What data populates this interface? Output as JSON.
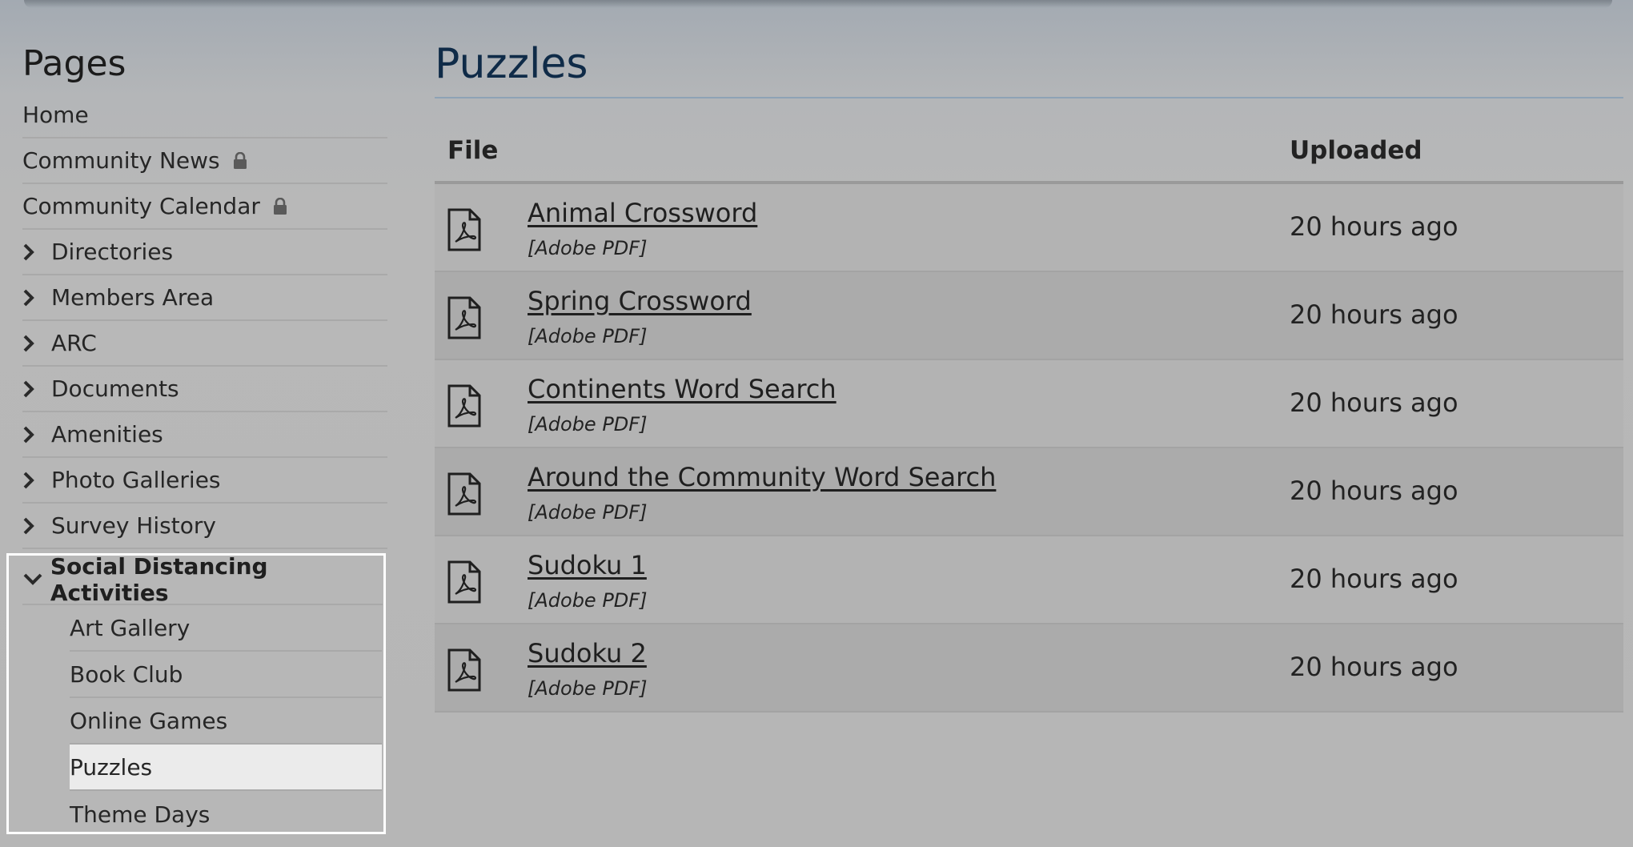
{
  "sidebar": {
    "title": "Pages",
    "items": [
      {
        "label": "Home",
        "icon": "",
        "locked": false
      },
      {
        "label": "Community News",
        "icon": "lock-icon",
        "locked": true
      },
      {
        "label": "Community Calendar",
        "icon": "lock-icon",
        "locked": true
      },
      {
        "label": "Directories",
        "icon": "chevron-right-icon",
        "locked": false
      },
      {
        "label": "Members Area",
        "icon": "chevron-right-icon",
        "locked": false
      },
      {
        "label": "ARC",
        "icon": "chevron-right-icon",
        "locked": false
      },
      {
        "label": "Documents",
        "icon": "chevron-right-icon",
        "locked": false
      },
      {
        "label": "Amenities",
        "icon": "chevron-right-icon",
        "locked": false
      },
      {
        "label": "Photo Galleries",
        "icon": "chevron-right-icon",
        "locked": false
      },
      {
        "label": "Survey History",
        "icon": "chevron-right-icon",
        "locked": false
      }
    ],
    "expanded": {
      "label": "Social Distancing Activities",
      "icon": "chevron-down-icon",
      "children": [
        {
          "label": "Art Gallery"
        },
        {
          "label": "Book Club"
        },
        {
          "label": "Online Games"
        },
        {
          "label": "Puzzles",
          "active": true
        },
        {
          "label": "Theme Days"
        }
      ]
    }
  },
  "main": {
    "title": "Puzzles",
    "columns": {
      "file": "File",
      "uploaded": "Uploaded"
    },
    "files": [
      {
        "name": "Animal Crossword",
        "type": "[Adobe PDF]",
        "uploaded": "20 hours ago",
        "icon": "pdf-file-icon"
      },
      {
        "name": "Spring Crossword",
        "type": "[Adobe PDF]",
        "uploaded": "20 hours ago",
        "icon": "pdf-file-icon"
      },
      {
        "name": "Continents Word Search",
        "type": "[Adobe PDF]",
        "uploaded": "20 hours ago",
        "icon": "pdf-file-icon"
      },
      {
        "name": "Around the Community Word Search",
        "type": "[Adobe PDF]",
        "uploaded": "20 hours ago",
        "icon": "pdf-file-icon"
      },
      {
        "name": "Sudoku 1",
        "type": "[Adobe PDF]",
        "uploaded": "20 hours ago",
        "icon": "pdf-file-icon"
      },
      {
        "name": "Sudoku 2",
        "type": "[Adobe PDF]",
        "uploaded": "20 hours ago",
        "icon": "pdf-file-icon"
      }
    ]
  },
  "colors": {
    "title_blue": "#0f2b48",
    "active_bg": "#ebebeb"
  }
}
